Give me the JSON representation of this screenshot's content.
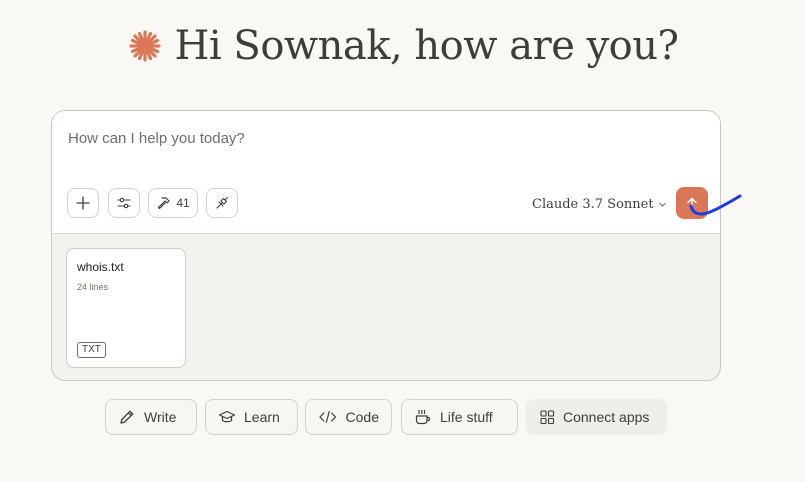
{
  "greeting": {
    "text": "Hi Sownak, how are you?",
    "icon": "claude-spark-icon",
    "accent": "#d97757"
  },
  "composer": {
    "placeholder": "How can I help you today?",
    "value": "",
    "tools": [
      {
        "name": "add-button",
        "icon": "plus-icon"
      },
      {
        "name": "options-button",
        "icon": "sliders-icon"
      },
      {
        "name": "tools-button",
        "icon": "hammer-icon",
        "count": "41"
      },
      {
        "name": "integrations-button",
        "icon": "plug-icon"
      }
    ],
    "model": "Claude 3.7 Sonnet",
    "send": {
      "icon": "arrow-up-icon",
      "color": "#d97757"
    }
  },
  "attachment": {
    "filename": "whois.txt",
    "meta": "24 lines",
    "type": "TXT"
  },
  "chips": [
    {
      "label": "Write",
      "icon": "pencil-icon"
    },
    {
      "label": "Learn",
      "icon": "graduation-cap-icon"
    },
    {
      "label": "Code",
      "icon": "code-icon"
    },
    {
      "label": "Life stuff",
      "icon": "coffee-icon"
    },
    {
      "label": "Connect apps",
      "icon": "apps-grid-icon"
    }
  ],
  "annotation_color": "#1a3ae6"
}
